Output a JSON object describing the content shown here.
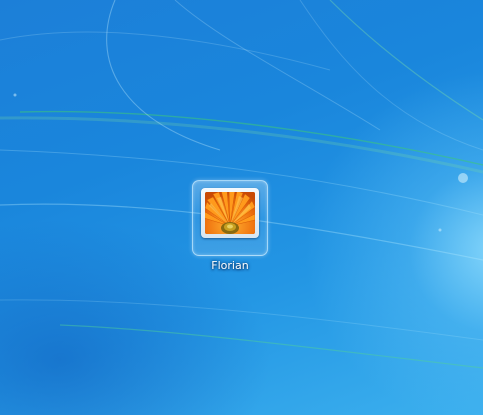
{
  "login": {
    "user": {
      "name": "Florian",
      "picture_icon": "orange-flower-icon"
    }
  },
  "colors": {
    "background": "#1a78d6",
    "background_highlight": "#9fe1ff",
    "tile_border": "#c8ebff",
    "username_text": "#ffffff",
    "flower_orange": "#e86a08"
  }
}
